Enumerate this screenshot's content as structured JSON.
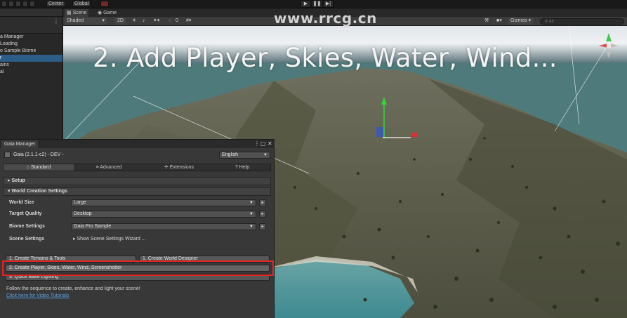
{
  "toolbar": {
    "pivot_label": "Center",
    "space_label": "Global",
    "play_icons": [
      "play-icon",
      "pause-icon",
      "step-icon"
    ]
  },
  "hierarchy": {
    "items": [
      {
        "label": "a Manager",
        "selected": false
      },
      {
        "label": "Loading",
        "selected": false
      },
      {
        "label": "o Sample Biome",
        "selected": false
      },
      {
        "label": "r",
        "selected": true
      },
      {
        "label": "ains",
        "selected": false
      },
      {
        "label": "al",
        "selected": false
      }
    ]
  },
  "scene": {
    "tabs": [
      "Scene",
      "Game"
    ],
    "draw_mode": "Shaded",
    "mode_2d": "2D",
    "hidden_count": "0",
    "gizmos_label": "Gizmos",
    "search_placeholder": "All"
  },
  "overlay": {
    "title": "2. Add Player, Skies, Water, Wind..."
  },
  "watermark": "www.rrcg.cn",
  "gaia": {
    "window_tab": "Gaia Manager",
    "header": "Gaia (2.1.1-c2) - DEV -",
    "language": "English",
    "tabs": [
      "Standard",
      "Advanced",
      "Extensions",
      "Help"
    ],
    "setup_label": "Setup",
    "world_creation_label": "World Creation Settings",
    "rows": [
      {
        "label": "World Size",
        "value": "Large"
      },
      {
        "label": "Target Quality",
        "value": "Desktop"
      },
      {
        "label": "Biome Settings",
        "value": "Gaia Pro Sample"
      }
    ],
    "scene_settings_label": "Scene Settings",
    "scene_settings_value": "Show Scene Settings Wizard ...",
    "buttons": {
      "create_terrains": "1. Create Terrains & Tools",
      "create_world_designer": "1. Create World Designer",
      "create_player": "2. Create Player, Skies, Water, Wind, Screenshotter",
      "quick_bake": "3. Quick Bake Lighting"
    },
    "hint": "Follow the sequence to create, enhance and light your scene!",
    "link": "Click here for Video Tutorials"
  },
  "colors": {
    "editor_bg": "#383838",
    "selection": "#2c5d87",
    "highlight_box": "#e02626",
    "link": "#5a9fe6"
  }
}
